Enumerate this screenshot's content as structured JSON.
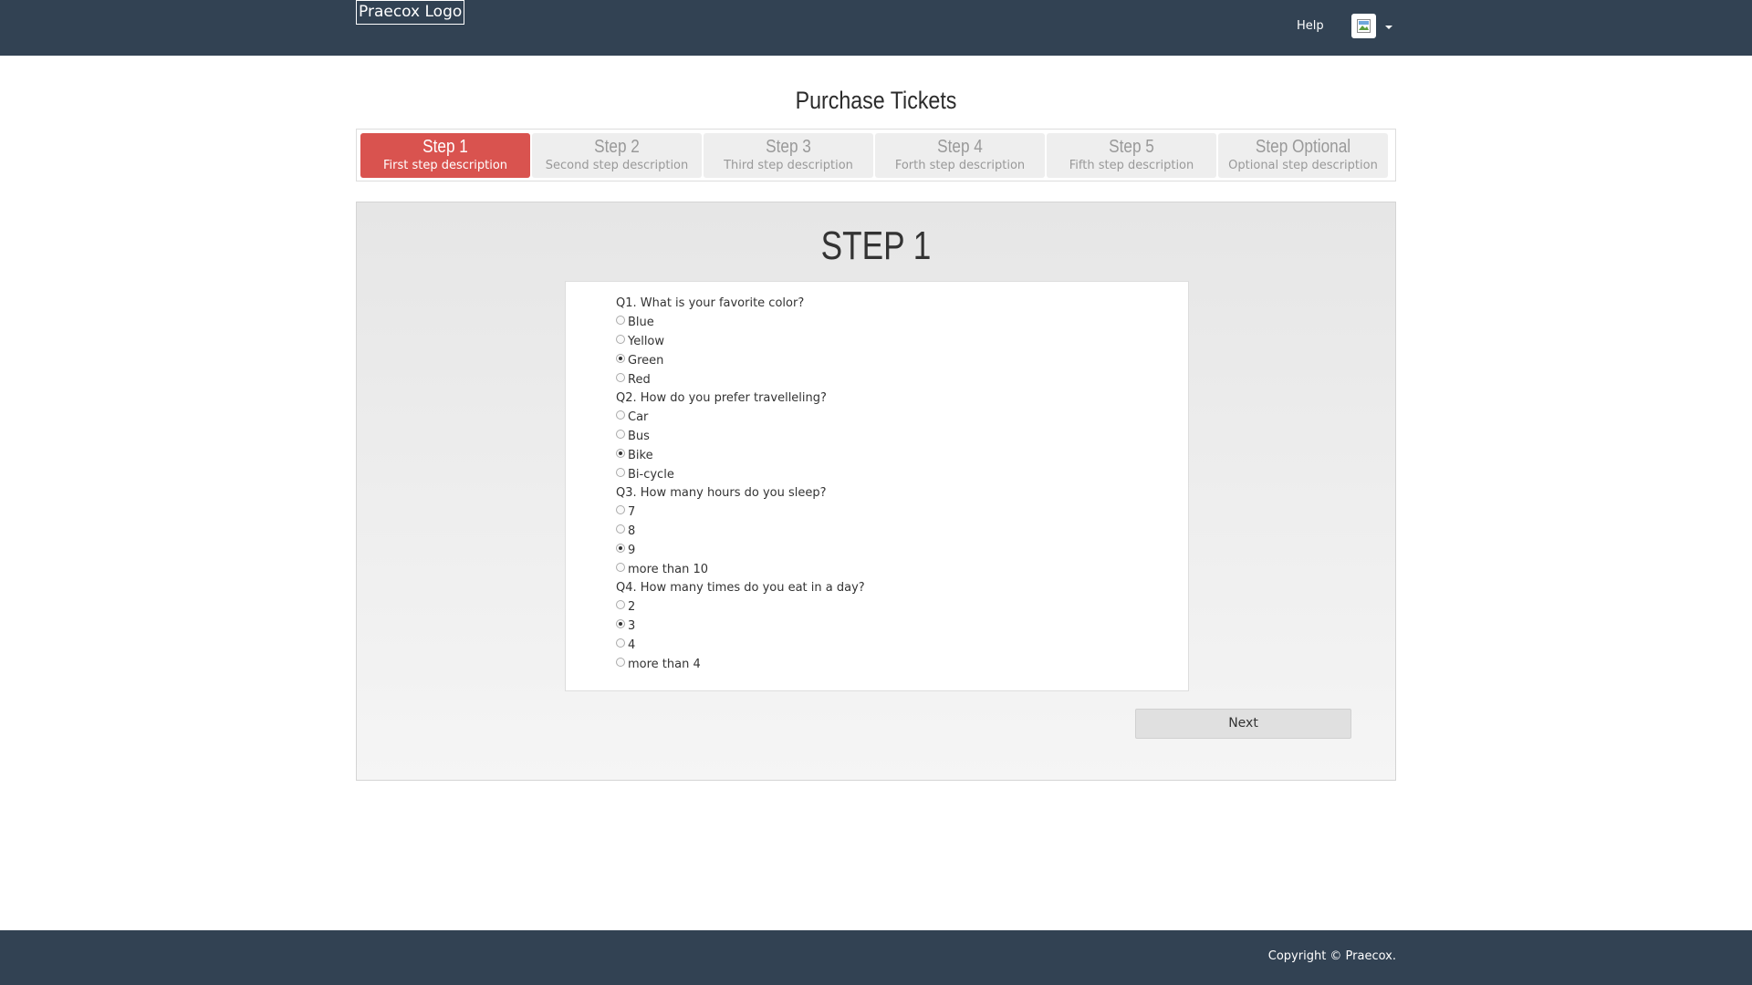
{
  "header": {
    "logo_text": "Praecox Logo",
    "help_label": "Help",
    "user_menu_icon": "broken-image-icon",
    "background_color": "#324253"
  },
  "page": {
    "title": "Purchase Tickets"
  },
  "stepper": {
    "active_color": "#d9534f",
    "steps": [
      {
        "title": "Step 1",
        "description": "First step description",
        "active": true
      },
      {
        "title": "Step 2",
        "description": "Second step description",
        "active": false
      },
      {
        "title": "Step 3",
        "description": "Third step description",
        "active": false
      },
      {
        "title": "Step 4",
        "description": "Forth step description",
        "active": false
      },
      {
        "title": "Step 5",
        "description": "Fifth step description",
        "active": false
      },
      {
        "title": "Step Optional",
        "description": "Optional step description",
        "active": false
      }
    ]
  },
  "panel": {
    "heading": "STEP 1",
    "questions": [
      {
        "text": "Q1. What is your favorite color?",
        "options": [
          "Blue",
          "Yellow",
          "Green",
          "Red"
        ],
        "selected": "Green"
      },
      {
        "text": "Q2. How do you prefer travelleling?",
        "options": [
          "Car",
          "Bus",
          "Bike",
          "Bi-cycle"
        ],
        "selected": "Bike"
      },
      {
        "text": "Q3. How many hours do you sleep?",
        "options": [
          "7",
          "8",
          "9",
          "more than 10"
        ],
        "selected": "9"
      },
      {
        "text": "Q4. How many times do you eat in a day?",
        "options": [
          "2",
          "3",
          "4",
          "more than 4"
        ],
        "selected": "3"
      }
    ],
    "next_label": "Next"
  },
  "footer": {
    "copyright": "Copyright © Praecox."
  }
}
